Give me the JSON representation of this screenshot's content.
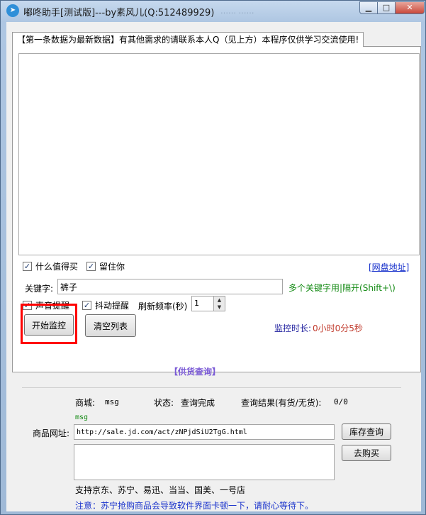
{
  "window": {
    "title": "嘟咚助手[测试版]---by素风儿(Q:512489929)",
    "title_faded": "……  ……",
    "min_glyph": "▁",
    "max_glyph": "□",
    "close_glyph": "✕"
  },
  "tab": {
    "header": "【第一条数据为最新数据】有其他需求的请联系本人Q（见上方）本程序仅供学习交流使用!"
  },
  "options": {
    "smzdm_label": "什么值得买",
    "smzdm_checked": true,
    "liuzhuni_label": "留住你",
    "liuzhuni_checked": true,
    "netdisk_link": "[网盘地址]"
  },
  "keyword": {
    "label": "关键字:",
    "value": "裤子",
    "hint": "多个关键字用|隔开(Shift+\\)"
  },
  "alerts": {
    "sound_label": "声音提醒",
    "sound_checked": true,
    "shake_label": "抖动提醒",
    "shake_checked": true,
    "refresh_label": "刷新频率(秒)",
    "refresh_value": "1",
    "up_glyph": "▲",
    "down_glyph": "▼"
  },
  "buttons": {
    "start": "开始监控",
    "clear": "清空列表",
    "stock_query": "库存查询",
    "buy": "去购买"
  },
  "monitor": {
    "duration_label": "监控时长:",
    "duration_value": "0小时0分5秒"
  },
  "supply": {
    "section_title": "【供货查询】",
    "mall_label": "商城:",
    "mall_value": "msg",
    "status_label": "状态:",
    "status_value": "查询完成",
    "result_label": "查询结果(有货/无货):",
    "result_value": "0/0",
    "msg_line": "msg",
    "url_label": "商品网址:",
    "url_value": "http://sale.jd.com/act/zNPjdSiU2TgG.html",
    "support_text": "支持京东、苏宁、易迅、当当、国美、一号店",
    "note_text": "注意：苏宁抢购商品会导致软件界面卡顿一下，请耐心等待下。"
  },
  "colors": {
    "link": "#1a33cc",
    "hint_green": "#138a13",
    "section_purple": "#7b5bd6",
    "label_navy": "#1a1a9c",
    "value_red": "#c0392b",
    "note_blue": "#1a33cc",
    "highlight_red": "#ff0000"
  }
}
